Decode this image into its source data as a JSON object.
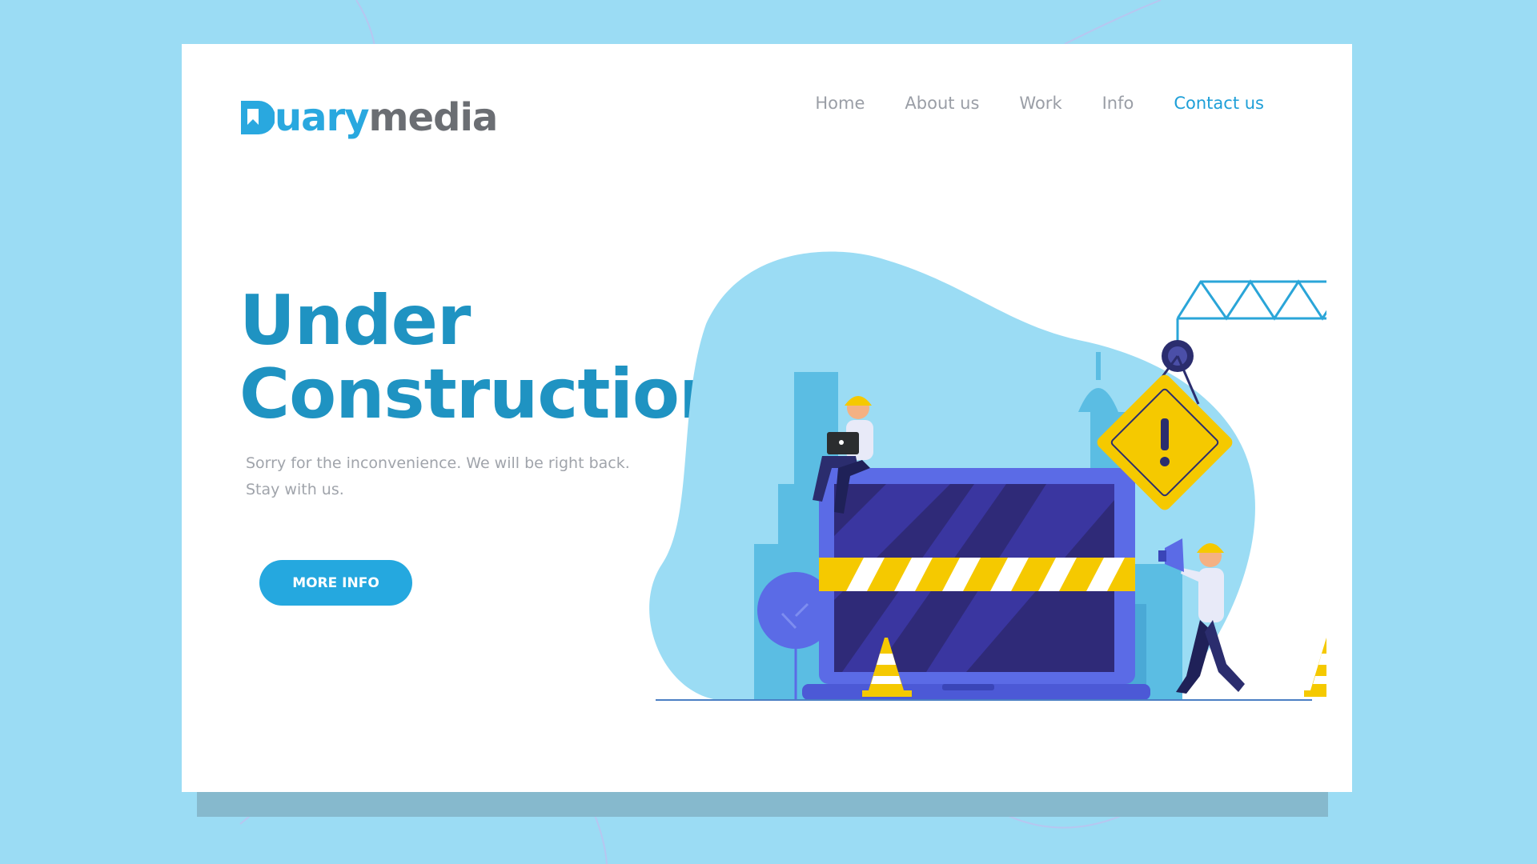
{
  "logo": {
    "part_a": "uary",
    "part_b": "media"
  },
  "nav": {
    "items": [
      "Home",
      "About us",
      "Work",
      "Info",
      "Contact us"
    ],
    "active_index": 4
  },
  "hero": {
    "title_line1": "Under",
    "title_line2": "Construction!",
    "subtitle_line1": "Sorry for the inconvenience. We will be right back.",
    "subtitle_line2": "Stay with us.",
    "cta_label": "MORE INFO"
  },
  "colors": {
    "background": "#9bdcf4",
    "accent": "#25a8df",
    "title": "#1f93c2",
    "nav_text": "#9a9ea6",
    "warning_yellow": "#f5c900",
    "laptop_blue": "#5b6be6",
    "screen_navy": "#2f2a78"
  },
  "icons": [
    "logo-mark-icon",
    "warning-sign-icon",
    "crane-icon",
    "laptop-icon",
    "traffic-cone-icon",
    "megaphone-icon",
    "tree-icon"
  ]
}
